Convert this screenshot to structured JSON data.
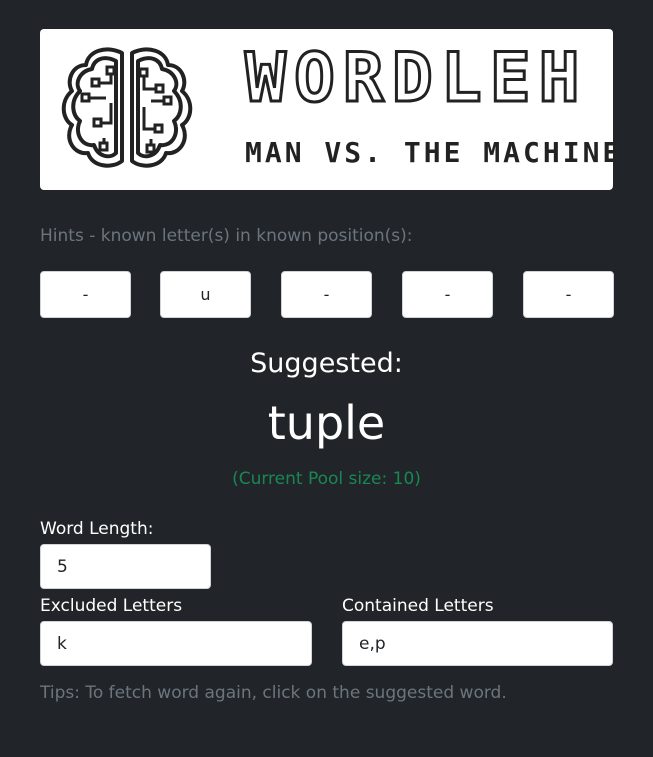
{
  "banner": {
    "title": "WORDLEH",
    "subtitle": "MAN VS. THE MACHINE"
  },
  "hints": {
    "label": "Hints - known letter(s) in known position(s):",
    "positions": [
      "-",
      "u",
      "-",
      "-",
      "-"
    ]
  },
  "suggestion": {
    "label": "Suggested:",
    "word": "tuple",
    "pool_text": "(Current Pool size: 10)",
    "pool_color": "#198754"
  },
  "word_length": {
    "label": "Word Length:",
    "value": "5"
  },
  "excluded": {
    "label": "Excluded Letters",
    "value": "k"
  },
  "contained": {
    "label": "Contained Letters",
    "value": "e,p"
  },
  "tips": "Tips: To fetch word again, click on the suggested word."
}
